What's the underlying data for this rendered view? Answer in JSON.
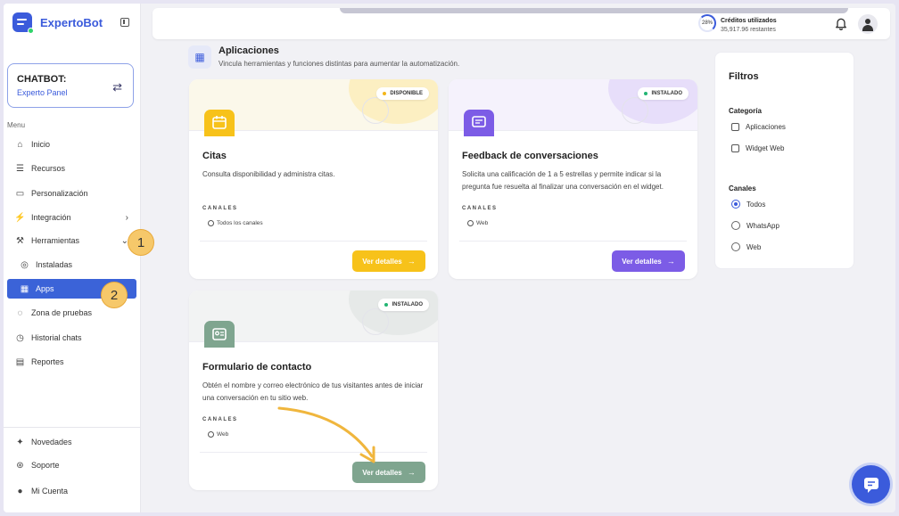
{
  "app": {
    "name": "ExpertoBot"
  },
  "chatbot": {
    "title": "CHATBOT:",
    "name": "Experto Panel"
  },
  "sidebar": {
    "menu_label": "Menu",
    "items": [
      {
        "label": "Inicio"
      },
      {
        "label": "Recursos"
      },
      {
        "label": "Personalización"
      },
      {
        "label": "Integración"
      },
      {
        "label": "Herramientas"
      },
      {
        "label": "Instaladas"
      },
      {
        "label": "Apps"
      },
      {
        "label": "Zona de pruebas"
      },
      {
        "label": "Historial chats"
      },
      {
        "label": "Reportes"
      }
    ],
    "bottom": [
      {
        "label": "Novedades"
      },
      {
        "label": "Soporte"
      },
      {
        "label": "Mi Cuenta"
      }
    ]
  },
  "annotations": {
    "step1": "1",
    "step2": "2"
  },
  "topbar": {
    "credits_percent": "28%",
    "credits_title": "Créditos utilizados",
    "credits_remaining": "35,917.96 restantes"
  },
  "page": {
    "title": "Aplicaciones",
    "subtitle": "Vincula herramientas y funciones distintas para aumentar la automatización."
  },
  "cards": [
    {
      "status": "DISPONIBLE",
      "title": "Citas",
      "description": "Consulta disponibilidad y administra citas.",
      "channels_label": "CANALES",
      "channels_value": "Todos los canales",
      "button": "Ver detalles"
    },
    {
      "status": "INSTALADO",
      "title": "Feedback de conversaciones",
      "description": "Solicita una calificación de 1 a 5 estrellas y permite indicar si la pregunta fue resuelta al finalizar una conversación en el widget.",
      "channels_label": "CANALES",
      "channels_value": "Web",
      "button": "Ver detalles"
    },
    {
      "status": "INSTALADO",
      "title": "Formulario de contacto",
      "description": "Obtén el nombre y correo electrónico de tus visitantes antes de iniciar una conversación en tu sitio web.",
      "channels_label": "CANALES",
      "channels_value": "Web",
      "button": "Ver detalles"
    }
  ],
  "filters": {
    "title": "Filtros",
    "category_label": "Categoría",
    "categories": [
      "Aplicaciones",
      "Widget Web"
    ],
    "channels_label": "Canales",
    "channels": [
      "Todos",
      "WhatsApp",
      "Web"
    ],
    "selected_channel": "Todos"
  },
  "colors": {
    "brand": "#3b5bdb",
    "active_nav": "#3b63d8",
    "yellow_button": "#f7c21a",
    "purple_button": "#7c5ce6",
    "green_button": "#7fa58f",
    "annotation": "#f6c86a"
  }
}
